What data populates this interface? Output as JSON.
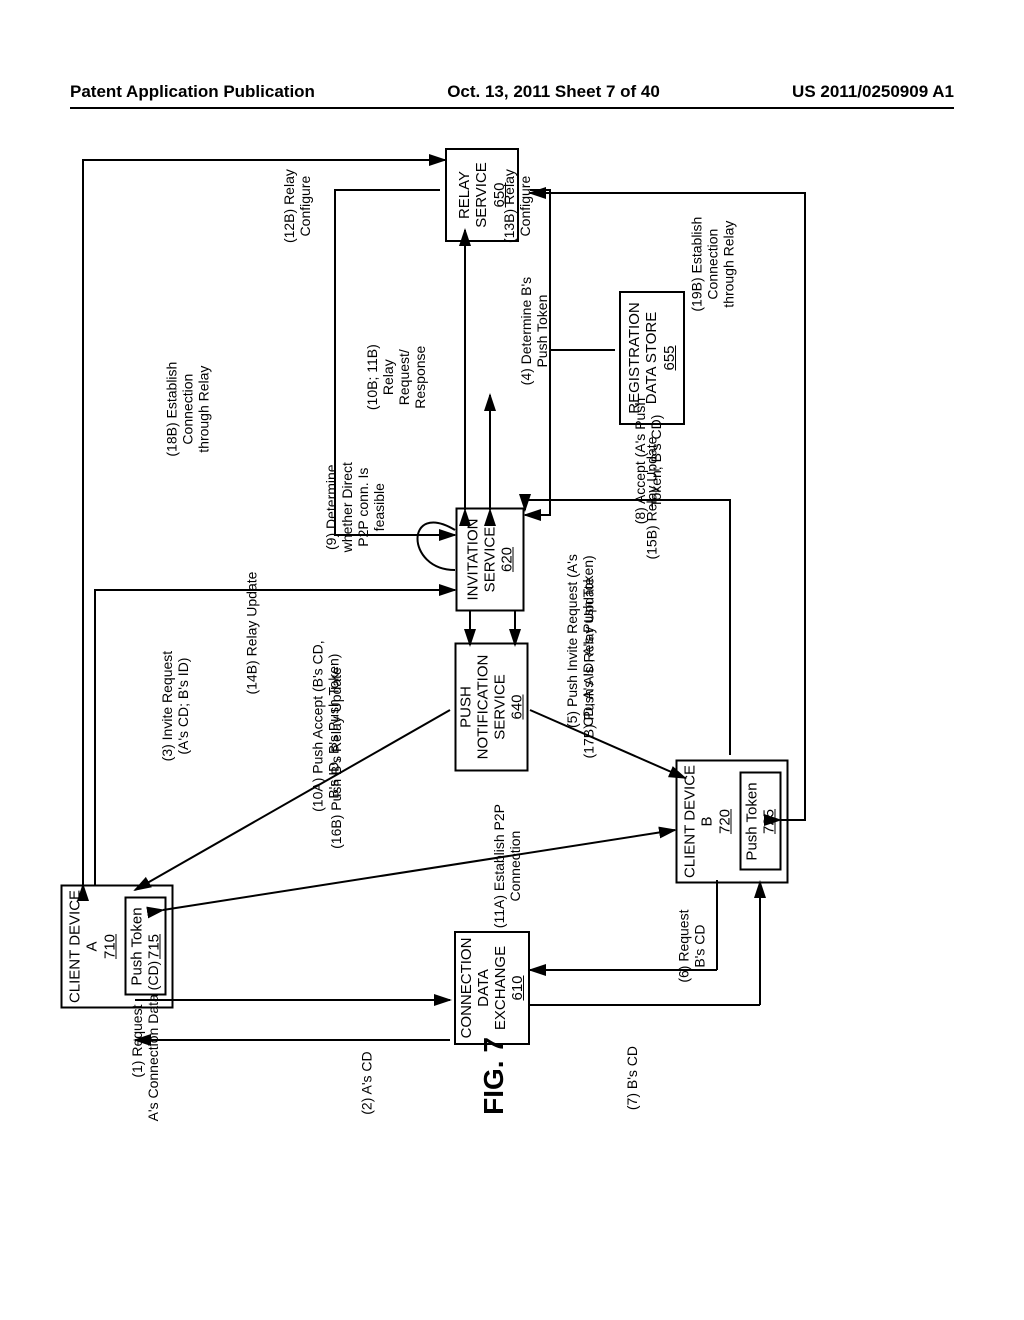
{
  "header": {
    "left": "Patent Application Publication",
    "center": "Oct. 13, 2011  Sheet 7 of 40",
    "right": "US 2011/0250909 A1"
  },
  "figure_label": "FIG. 7",
  "boxes": {
    "relay": {
      "title": "RELAY\nSERVICE",
      "num": "650"
    },
    "regstore": {
      "title": "REGISTRATION\nDATA STORE",
      "num": "655"
    },
    "invite": {
      "title": "INVITATION\nSERVICE",
      "num": "620"
    },
    "push": {
      "title": "PUSH\nNOTIFICATION\nSERVICE",
      "num": "640"
    },
    "cdx": {
      "title": "CONNECTION\nDATA\nEXCHANGE",
      "num": "610"
    },
    "clientA": {
      "title": "CLIENT DEVICE\nA",
      "num": "710"
    },
    "tokenA": {
      "title": "Push Token",
      "num": "715"
    },
    "clientB": {
      "title": "CLIENT DEVICE\nB",
      "num": "720"
    },
    "tokenB": {
      "title": "Push Token",
      "num": "725"
    }
  },
  "edges": {
    "e1": "(1) Request\nA's Connection Data (CD)",
    "e2": "(2) A's CD",
    "e3": "(3) Invite Request\n(A's CD; B's ID)",
    "e4": "(4) Determine B's\nPush Token",
    "e5": "(5) Push Invite Request (A's\nCD; A's ID; A's Push Token)",
    "e6": "(6) Request\nB's CD",
    "e7": "(7) B's CD",
    "e8": "(8) Accept (A's Push\nToken; B's CD)",
    "e9": "(9) Determine\nwhether Direct\nP2P conn. Is\nfeasible",
    "e10a": "(10A) Push Accept (B's CD,\nB's ID, B's Push Token)",
    "e10b": "(10B; 11B)\nRelay\nRequest/\nResponse",
    "e11a": "(11A) Establish P2P\nConnection",
    "e12b": "(12B) Relay\nConfigure",
    "e13b": "(13B) Relay\nConfigure",
    "e14b": "(14B) Relay Update",
    "e15b": "(15B) Relay Update",
    "e16b": "(16B) Push B's Relay Update",
    "e17b": "(17B) Push A's Relay Update",
    "e18b": "(18B) Establish\nConnection\nthrough Relay",
    "e19b": "(19B) Establish\nConnection\nthrough Relay"
  }
}
